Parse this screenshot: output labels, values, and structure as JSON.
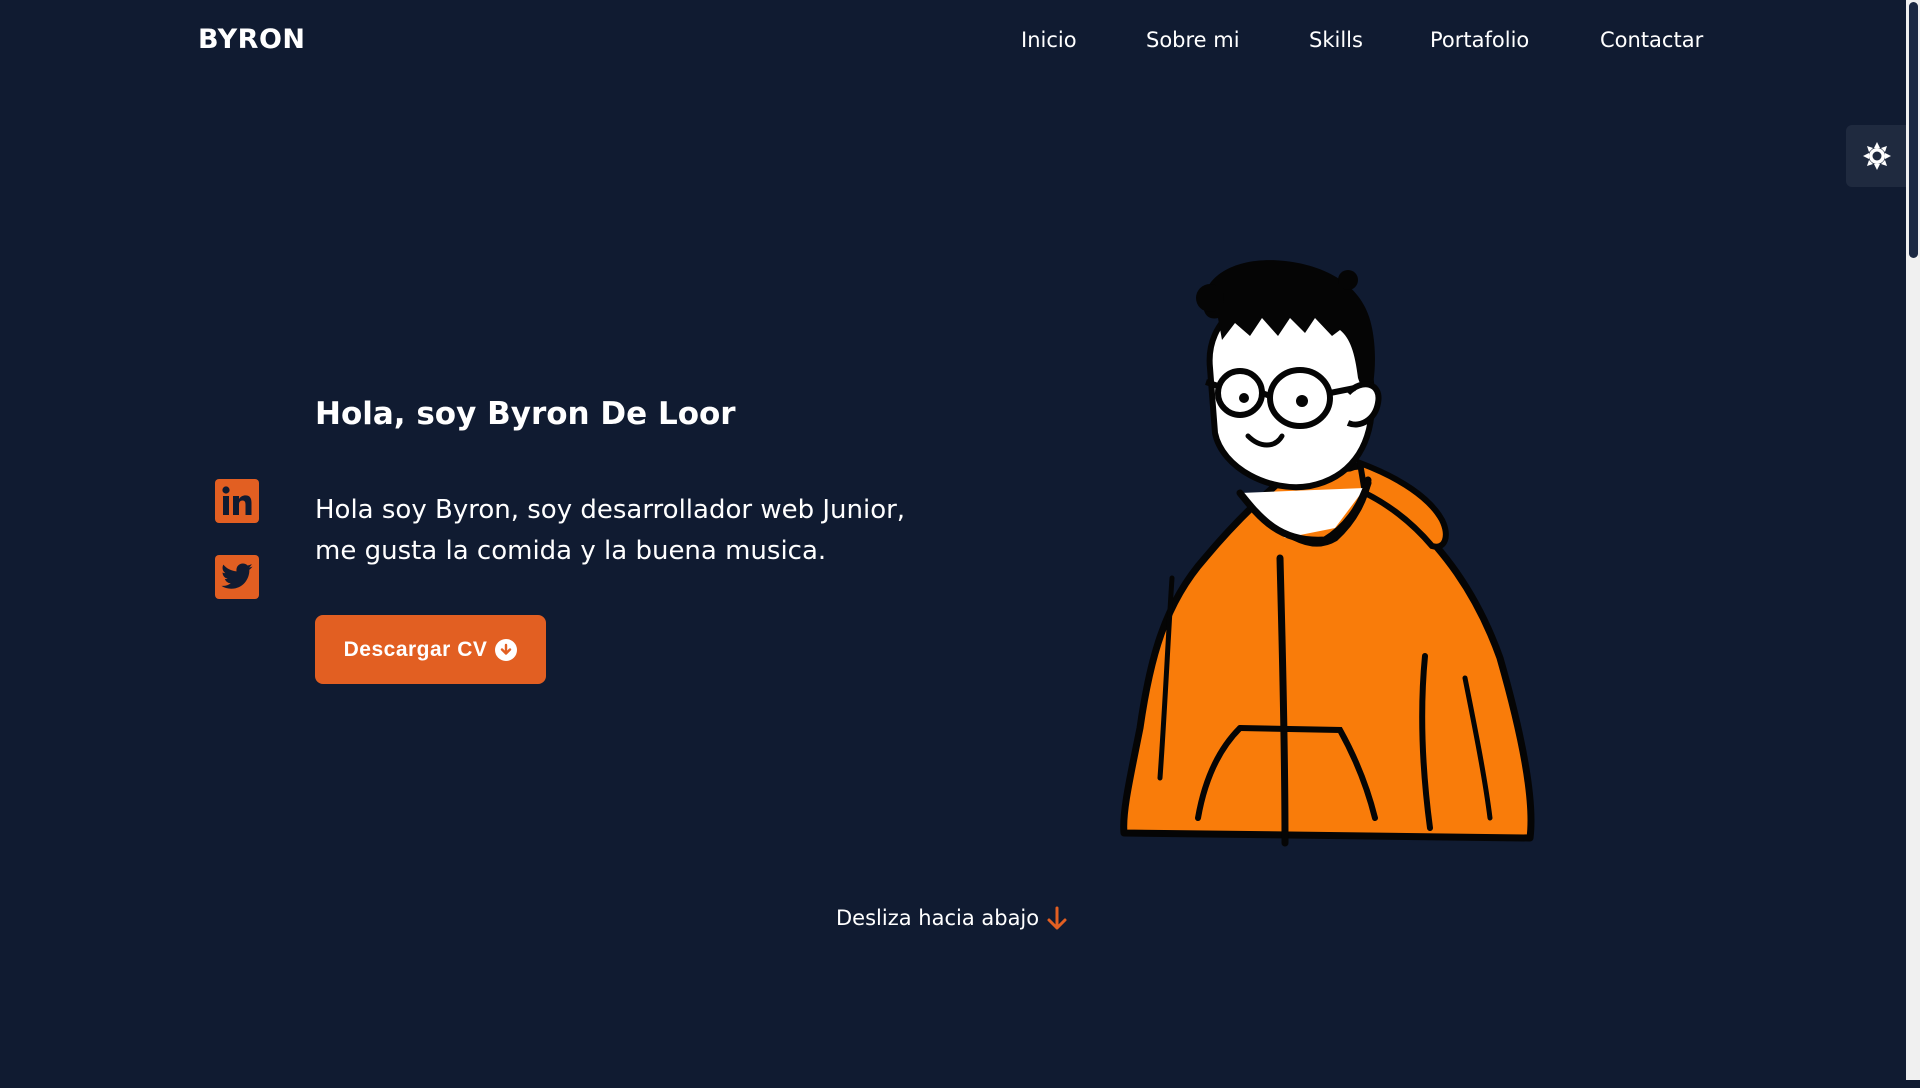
{
  "header": {
    "logo": "BYRON",
    "nav": [
      "Inicio",
      "Sobre mi",
      "Skills",
      "Portafolio",
      "Contactar"
    ]
  },
  "theme_toggle": {
    "icon": "sun-icon"
  },
  "social": [
    {
      "icon": "linkedin-icon"
    },
    {
      "icon": "twitter-icon"
    }
  ],
  "hero": {
    "title": "Hola, soy Byron De Loor",
    "description_line1": "Hola soy Byron, soy desarrollador web Junior,",
    "description_line2": "me gusta la comida y la buena musica.",
    "cv_button": "Descargar CV"
  },
  "scroll_hint": "Desliza hacia abajo",
  "colors": {
    "background": "#101b31",
    "accent": "#e25f22",
    "hoodie": "#f97c0a",
    "text": "#ffffff"
  }
}
